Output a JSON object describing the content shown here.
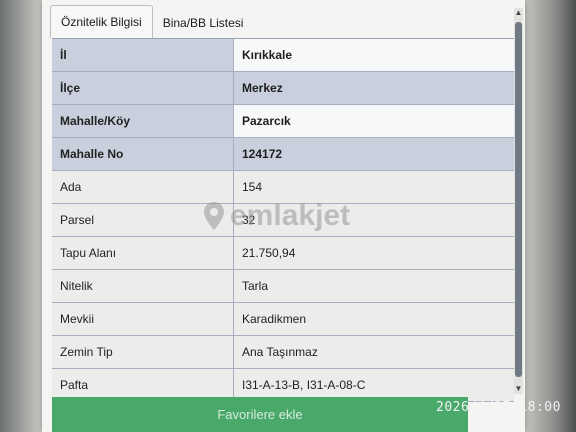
{
  "tabs": [
    {
      "label": "Öznitelik Bilgisi",
      "active": true
    },
    {
      "label": "Bina/BB Listesi",
      "active": false
    }
  ],
  "rows": [
    {
      "label": "İl",
      "value": "Kırıkkale"
    },
    {
      "label": "İlçe",
      "value": "Merkez"
    },
    {
      "label": "Mahalle/Köy",
      "value": "Pazarcık"
    },
    {
      "label": "Mahalle No",
      "value": "124172"
    },
    {
      "label": "Ada",
      "value": "154"
    },
    {
      "label": "Parsel",
      "value": "32"
    },
    {
      "label": "Tapu Alanı",
      "value": "21.750,94"
    },
    {
      "label": "Nitelik",
      "value": "Tarla"
    },
    {
      "label": "Mevkii",
      "value": "Karadikmen"
    },
    {
      "label": "Zemin Tip",
      "value": "Ana Taşınmaz"
    },
    {
      "label": "Pafta",
      "value": "I31-A-13-B, I31-A-08-C"
    }
  ],
  "favorite_button": {
    "label": "Favorilere ekle"
  },
  "watermark": {
    "text": "emlakjet"
  },
  "camera_timestamp": "2026/4/27  18:00",
  "colors": {
    "accent_green": "#49a96a",
    "header_row": "#c9cfdd"
  },
  "icons": {
    "scroll_up": "chevron-up-icon",
    "scroll_down": "chevron-down-icon",
    "watermark_logo": "location-pin-icon"
  }
}
